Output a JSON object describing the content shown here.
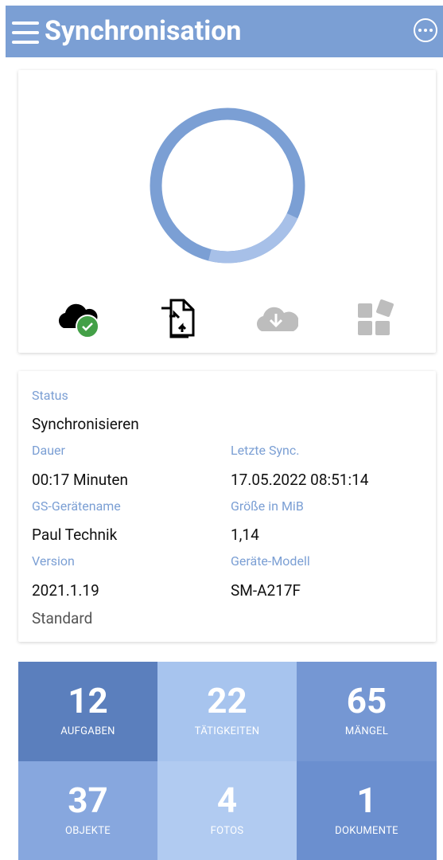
{
  "header": {
    "title": "Synchronisation",
    "menu_icon": "hamburger-menu-icon",
    "more_icon": "more-options-icon"
  },
  "sync": {
    "progress": 0.22,
    "ring_color": "#7b9fd4",
    "ring_progress_color": "#a7c0e8",
    "steps": [
      {
        "name": "cloud-check-icon",
        "state": "done"
      },
      {
        "name": "documents-sync-icon",
        "state": "active"
      },
      {
        "name": "cloud-download-icon",
        "state": "pending"
      },
      {
        "name": "modules-icon",
        "state": "pending"
      }
    ]
  },
  "info": {
    "status_label": "Status",
    "status_value": "Synchronisieren",
    "duration_label": "Dauer",
    "duration_value": "00:17 Minuten",
    "last_sync_label": "Letzte Sync.",
    "last_sync_value": "17.05.2022 08:51:14",
    "device_name_label": "GS-Gerätename",
    "device_name_value": "Paul Technik",
    "size_label": "Größe in MiB",
    "size_value": "1,14",
    "version_label": "Version",
    "version_value": "2021.1.19",
    "model_label": "Geräte-Modell",
    "model_value": "SM-A217F",
    "edition_value": "Standard"
  },
  "tiles": [
    {
      "count": "12",
      "label": "AUFGABEN",
      "color": "#5b7fbd"
    },
    {
      "count": "22",
      "label": "TÄTIGKEITEN",
      "color": "#a7c4ee"
    },
    {
      "count": "65",
      "label": "MÄNGEL",
      "color": "#7597d3"
    },
    {
      "count": "37",
      "label": "OBJEKTE",
      "color": "#87a7de"
    },
    {
      "count": "4",
      "label": "FOTOS",
      "color": "#b1cbf1"
    },
    {
      "count": "1",
      "label": "DOKUMENTE",
      "color": "#6b8fcf"
    }
  ]
}
